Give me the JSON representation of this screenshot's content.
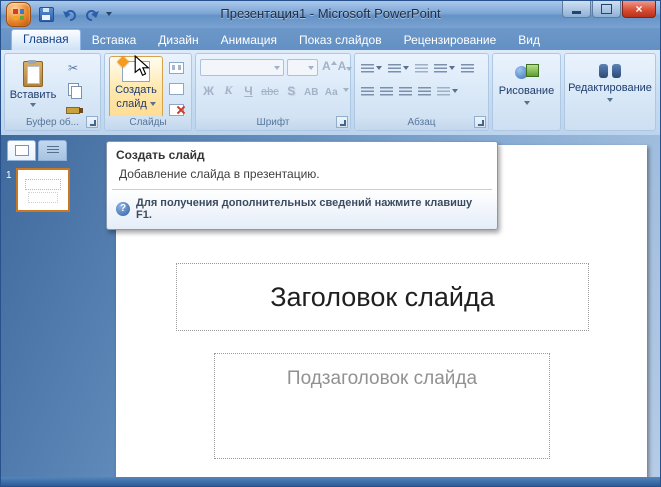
{
  "window": {
    "title": "Презентация1 - Microsoft PowerPoint"
  },
  "titlebar": {
    "close_glyph": "×"
  },
  "tabs": [
    {
      "label": "Главная"
    },
    {
      "label": "Вставка"
    },
    {
      "label": "Дизайн"
    },
    {
      "label": "Анимация"
    },
    {
      "label": "Показ слайдов"
    },
    {
      "label": "Рецензирование"
    },
    {
      "label": "Вид"
    }
  ],
  "ribbon": {
    "clipboard": {
      "group_label": "Буфер об...",
      "paste_label": "Вставить"
    },
    "slides": {
      "group_label": "Слайды",
      "new_slide_line1": "Создать",
      "new_slide_line2": "слайд"
    },
    "font": {
      "group_label": "Шрифт",
      "bold": "Ж",
      "italic": "К",
      "underline": "Ч",
      "strikethrough": "abc",
      "shadow": "S",
      "spacing": "АВ",
      "change_case": "Аа",
      "grow": "А",
      "shrink": "А"
    },
    "paragraph": {
      "group_label": "Абзац"
    },
    "drawing": {
      "button_label": "Рисование"
    },
    "editing": {
      "button_label": "Редактирование"
    }
  },
  "tooltip": {
    "title": "Создать слайд",
    "body": "Добавление слайда в презентацию.",
    "help": "Для получения дополнительных сведений нажмите клавишу F1.",
    "help_glyph": "?"
  },
  "slides_panel": {
    "slide_number": "1"
  },
  "slide": {
    "title_placeholder": "Заголовок слайда",
    "subtitle_placeholder": "Подзаголовок слайда"
  },
  "colors": {
    "titlebar_blue": "#6592c6",
    "ribbon_blue": "#c7dcf1",
    "hover_orange": "#ffd98a",
    "selection_border_orange": "#c87820",
    "close_red": "#d6492f"
  }
}
